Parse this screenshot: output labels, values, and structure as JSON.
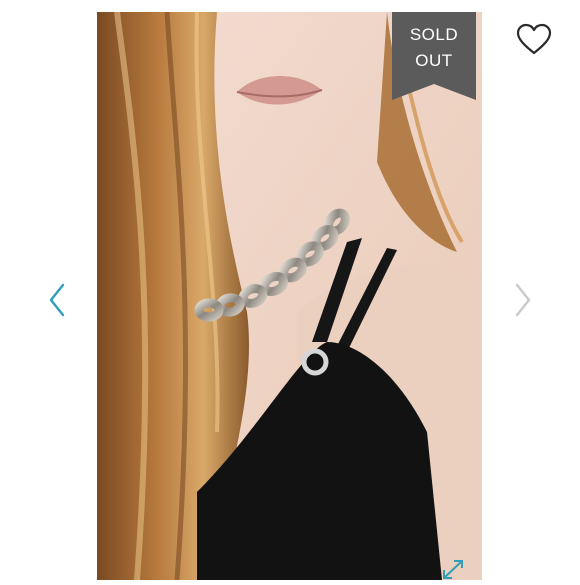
{
  "listing": {
    "status_line1": "SOLD",
    "status_line2": "OUT",
    "colors": {
      "ribbon": "#5b5b5b",
      "prev_arrow": "#2e9fb4",
      "next_arrow": "#c9c9c9",
      "expand_icon": "#2e9fb4",
      "heart_outline": "#2b2b2b"
    }
  },
  "icons": {
    "prev": "chevron-left-icon",
    "next": "chevron-right-icon",
    "like": "heart-icon",
    "expand": "expand-icon"
  }
}
